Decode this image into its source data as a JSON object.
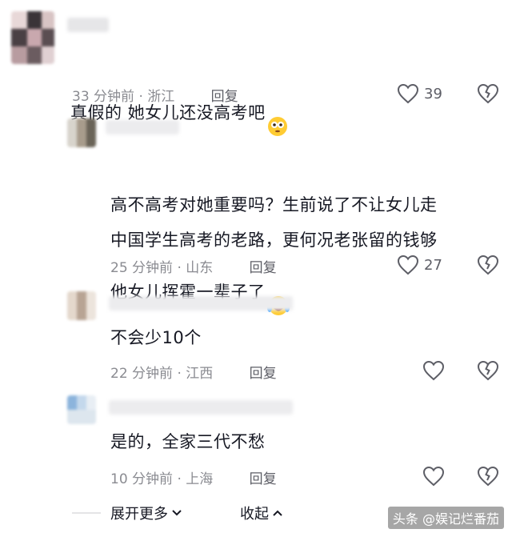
{
  "comments": [
    {
      "text": "真假的 她女儿还没高考吧",
      "emoji": "flushed-face-emoji",
      "time": "33 分钟前",
      "location": "浙江",
      "reply": "回复",
      "likes": "39"
    },
    {
      "text": "高不高考对她重要吗？生前说了不让女儿走\n中国学生高考的老路，更何况老张留的钱够\n他女儿挥霍一辈子了",
      "emoji": "laughing-crying-emoji",
      "time": "25 分钟前",
      "location": "山东",
      "reply": "回复",
      "likes": "27"
    },
    {
      "text": "不会少10个",
      "time": "22 分钟前",
      "location": "江西",
      "reply": "回复"
    },
    {
      "text": "是的，全家三代不愁",
      "time": "10 分钟前",
      "location": "上海",
      "reply": "回复"
    }
  ],
  "footer": {
    "expand": "展开更多",
    "collapse": "收起"
  },
  "watermark": "头条 @娱记烂番茄",
  "colors": {
    "meta": "#8a8b91",
    "text": "#161823",
    "reply": "#5d5e66"
  }
}
